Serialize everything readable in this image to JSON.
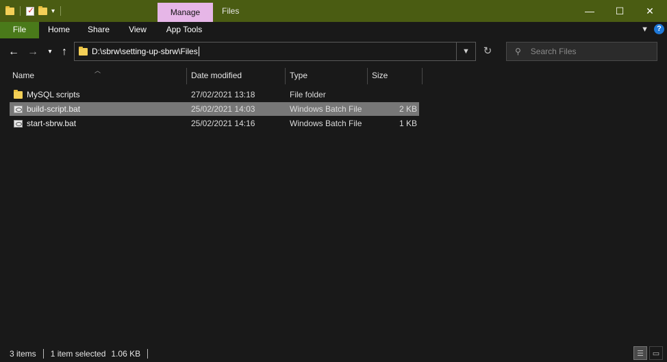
{
  "titlebar": {
    "context_tab": "Manage",
    "title": "Files",
    "minimize": "—",
    "maximize": "☐",
    "close": "✕"
  },
  "ribbon": {
    "tabs": [
      "File",
      "Home",
      "Share",
      "View",
      "App Tools"
    ],
    "help": "?"
  },
  "nav": {
    "address": "D:\\sbrw\\setting-up-sbrw\\Files",
    "search_placeholder": "Search Files"
  },
  "columns": [
    "Name",
    "Date modified",
    "Type",
    "Size"
  ],
  "files": [
    {
      "name": "MySQL scripts",
      "date": "27/02/2021 13:18",
      "type": "File folder",
      "size": "",
      "kind": "folder",
      "selected": false
    },
    {
      "name": "build-script.bat",
      "date": "25/02/2021 14:03",
      "type": "Windows Batch File",
      "size": "2 KB",
      "kind": "bat",
      "selected": true
    },
    {
      "name": "start-sbrw.bat",
      "date": "25/02/2021 14:16",
      "type": "Windows Batch File",
      "size": "1 KB",
      "kind": "bat",
      "selected": false
    }
  ],
  "status": {
    "items_count": "3 items",
    "selection": "1 item selected",
    "size": "1.06 KB"
  },
  "colors": {
    "titlebar": "#4a5c12",
    "file_tab": "#4a7a1a",
    "context_tab": "#e6b6e7",
    "selected_row": "#777777",
    "background": "#191919"
  }
}
